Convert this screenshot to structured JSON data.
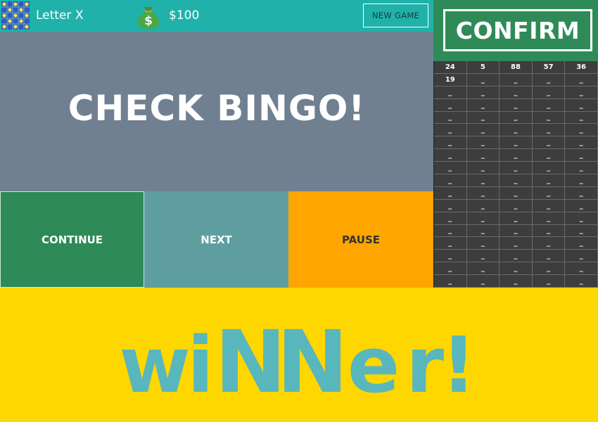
{
  "header": {
    "pattern_icon": "bingo-pattern-icon",
    "pattern_name": "Letter X",
    "money_icon": "money-bag-icon",
    "money_amount": "$100",
    "new_game_label": "NEW GAME"
  },
  "confirm": {
    "label": "CONFIRM"
  },
  "called_numbers": {
    "columns": 5,
    "rows": 18,
    "values": [
      "24",
      "5",
      "88",
      "57",
      "36",
      "19"
    ],
    "empty_marker": "_"
  },
  "check_bingo": {
    "text": "CHECK BINGO!"
  },
  "actions": {
    "continue_label": "CONTINUE",
    "next_label": "NEXT",
    "pause_label": "PAUSE"
  },
  "winner": {
    "letters": [
      "w",
      "i",
      "N",
      "N",
      "e",
      "r",
      "!"
    ],
    "text_color": "#5ab8bf",
    "background_color": "#ffd700"
  },
  "colors": {
    "header": "#20b2aa",
    "confirm_panel": "#2e8b57",
    "check_bingo_panel": "#708090",
    "continue": "#2e8b57",
    "next": "#5f9ea0",
    "pause": "#ffa500",
    "grid": "#3d3d3d"
  }
}
